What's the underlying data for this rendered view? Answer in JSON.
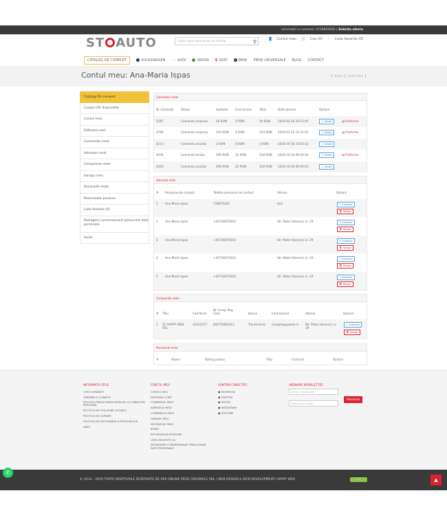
{
  "topbar": {
    "info": "Informatii si comenzi: ",
    "phone": "0729859002",
    "sep": " | ",
    "offer": "Solicita oferta"
  },
  "header": {
    "search_placeholder": "Cauta dupa codul piesei de schimb",
    "account": "Contul meu",
    "cart": "Cos (0)",
    "wishlist": "Lista favorite (0)"
  },
  "nav": [
    {
      "label": "CATALOG OE COMPLET",
      "icon": "none"
    },
    {
      "label": "VOLKSWAGEN",
      "icon": "vw-logo-icon"
    },
    {
      "label": "AUDI",
      "icon": "audi-logo-icon"
    },
    {
      "label": "SKODA",
      "icon": "skoda-logo-icon"
    },
    {
      "label": "SEAT",
      "icon": "seat-logo-icon"
    },
    {
      "label": "BMW",
      "icon": "bmw-logo-icon"
    },
    {
      "label": "PIESE UNIVERSALE",
      "icon": "none"
    },
    {
      "label": "BLOG",
      "icon": "none"
    },
    {
      "label": "CONTACT",
      "icon": "none"
    }
  ],
  "page": {
    "title": "Contul meu: Ana-Maria Ispas",
    "crumb_home": "Acasa",
    "crumb_current": "Contul meu"
  },
  "sidebar": [
    "Catalog OE complet",
    "Cautari OE disponibile",
    "Contul meu",
    "Editeaza cont",
    "Comenzile mele",
    "Adresele mele",
    "Companiile mele",
    "Garajul meu",
    "Recenziile mele",
    "Returneaza produse",
    "Lista favorite (0)",
    "Retragere consimtamant prelucrare date personale",
    "Iesire"
  ],
  "orders": {
    "title": "Comenzile mele",
    "headers": [
      "Nr comanda",
      "Status",
      "Subtotal",
      "Cost livrare",
      "Total",
      "Data plasare",
      "Optiuni"
    ],
    "rows": [
      {
        "nr": "5287",
        "status": "Comanda respinsa",
        "subtotal": "54 RON",
        "livrare": "0 RON",
        "total": "54 RON",
        "data": "2019-03-28 20:12:45",
        "proforma": true
      },
      {
        "nr": "4766",
        "status": "Comanda respinsa",
        "subtotal": "310 RON",
        "livrare": "0 RON",
        "total": "310 RON",
        "data": "2019-01-25 15:31:45",
        "proforma": true
      },
      {
        "nr": "4213",
        "status": "Comanda anulata",
        "subtotal": "3 RON",
        "livrare": "0 RON",
        "total": "3 RON",
        "data": "2018-10-30 15:05:13",
        "proforma": false
      },
      {
        "nr": "4204",
        "status": "Comanda livrata",
        "subtotal": "296 RON",
        "livrare": "22 RON",
        "total": "318 RON",
        "data": "2018-10-30 09:44:10",
        "proforma": true
      },
      {
        "nr": "4203",
        "status": "Comanda anulata",
        "subtotal": "296 RON",
        "livrare": "22 RON",
        "total": "318 RON",
        "data": "2018-10-30 09:40:24",
        "proforma": false
      }
    ],
    "details_label": "Detalii",
    "proforma_label": "Proforma"
  },
  "addresses": {
    "title": "Adresele mele",
    "headers": [
      "#",
      "Persoana de contact",
      "Telefon persoana de contact",
      "Adresa",
      "Optiuni"
    ],
    "rows": [
      {
        "n": "1",
        "name": "Ana-Maria Ispas",
        "phone": "730670203",
        "addr": "test"
      },
      {
        "n": "2",
        "name": "Ana-Maria Ispas",
        "phone": "+40730670203",
        "addr": "Str. Matei Voievod, nr. 29"
      },
      {
        "n": "3",
        "name": "Ana-Maria Ispas",
        "phone": "+40730670203",
        "addr": "Str. Matei Voievod, nr. 29"
      },
      {
        "n": "4",
        "name": "Ana-Maria Ispas",
        "phone": "+40730670203",
        "addr": "Str. Matei Voievod, nr. 29"
      },
      {
        "n": "5",
        "name": "Ana-Maria Ispas",
        "phone": "+40730670203",
        "addr": "Str. Matei Voievod, nr. 29"
      }
    ],
    "edit_label": "Editeaza",
    "delete_label": "Sterge"
  },
  "companies": {
    "title": "Companiile mele",
    "headers": [
      "#",
      "Titlu",
      "Cod fiscal",
      "Nr. Inreg. Reg. Com.",
      "Banca",
      "Cont bancar",
      "Adresa",
      "Optiuni"
    ],
    "rows": [
      {
        "n": "1",
        "titlu": "SC HAPPY WEB SRL",
        "cod": "31633477",
        "reg": "J40/7538/2013",
        "banca": "Transilvania",
        "cont": "ana@happyweb.ro",
        "adresa": "Str. Matei Voievod, nr. 29"
      }
    ]
  },
  "reviews": {
    "title": "Recenziile mele",
    "headers": [
      "#",
      "Status",
      "Rating produs",
      "Titlu",
      "Continut",
      "Optiuni"
    ]
  },
  "footer": {
    "info": {
      "title": "INFORMATII UTILE",
      "items": [
        "CUM COMANZI?",
        "TERMENI SI CONDITII",
        "POLITICA PRELUCRARII DATELOR CU CARACTER PERSONAL",
        "POLITICA DE UTILIZARE COOKIES",
        "POLITICA DE LIVRARE",
        "POLITICA DE RETURNARE A PRODUSELOR",
        "ANPC"
      ]
    },
    "account": {
      "title": "CONTUL MEU",
      "items": [
        "CONTUL MEU",
        "EDITEAZA CONT",
        "COMENZILE MELE",
        "ADRESELE MELE",
        "COMPANIILE MELE",
        "GARAJUL MEU",
        "RECENZIILE MELE",
        "IESIRE",
        "RETURNEAZA PRODUSE",
        "LISTA FAVORITE (0)",
        "RETRAGERE CONSIMTAMANT PRELUCRARE DATE PERSONALE"
      ]
    },
    "social": {
      "title": "SUNTEM CONECTATI",
      "items": [
        "FACEBOOK",
        "TWITTER",
        "TIKTOK",
        "INSTAGRAM",
        "YOUTUBE"
      ]
    },
    "newsletter": {
      "title": "ABONARE NEWSLETTER",
      "name_ph": "Nume si prenume",
      "email_ph": "Adresa de e-mail",
      "button": "Aboneaza"
    }
  },
  "bottom": {
    "copyright": "© 2012 - 2025 TOATE DREPTURILE REZERVATE DE SRS ONLINE PIESE ORIGINALE SRL",
    "credit": " | WEB DESIGN & WEB DEVELOPMENT: HAPPY WEB"
  },
  "logo": {
    "left": "ST",
    "right": "AUTO"
  },
  "icons": {
    "whatsapp": "whatsapp-icon",
    "totop": "arrow-up-icon",
    "search": "search-icon",
    "user": "user-icon",
    "cart": "cart-icon",
    "heart": "heart-icon"
  }
}
